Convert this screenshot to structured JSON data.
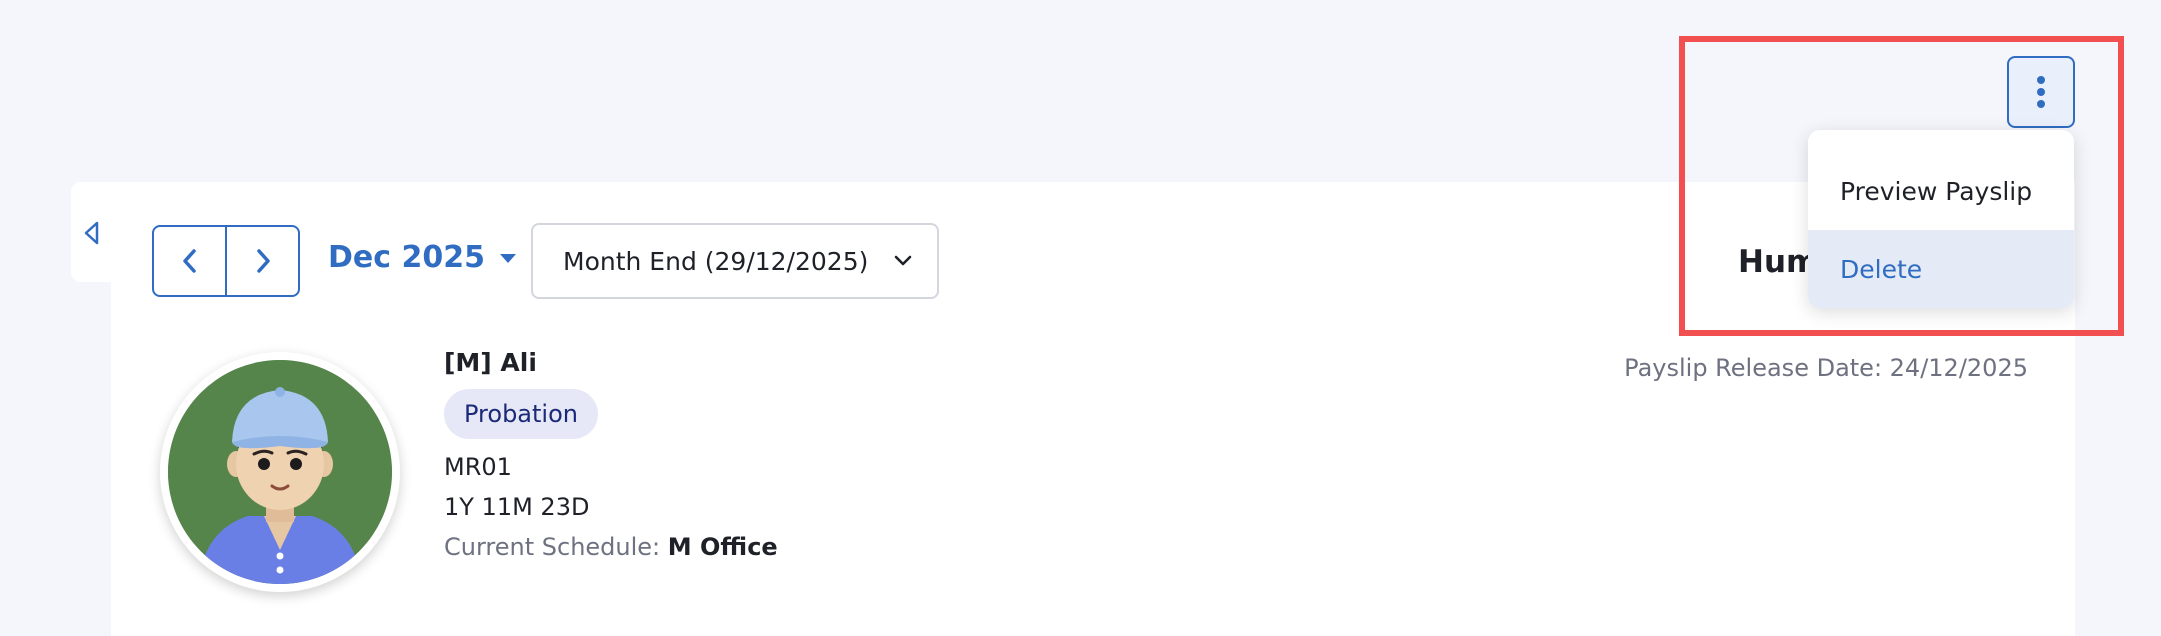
{
  "period": {
    "month_label": "Dec 2025",
    "payroll_run": "Month End (29/12/2025)"
  },
  "panel": {
    "heading_partial": "Hum"
  },
  "payslip": {
    "release_date": "Payslip Release Date: 24/12/2025"
  },
  "employee": {
    "name": "[M] Ali",
    "status_badge": "Probation",
    "employee_code": "MR01",
    "tenure": "1Y 11M 23D",
    "schedule_label": "Current Schedule:",
    "schedule_value": "M Office"
  },
  "actions_menu": {
    "items": [
      {
        "label": "Preview Payslip"
      },
      {
        "label": "Delete"
      }
    ]
  },
  "colors": {
    "accent": "#2f6cc2",
    "highlight": "#f25050",
    "badge_bg": "#e6e8f7"
  },
  "icons": {
    "collapse": "triangle-left-icon",
    "prev": "chevron-left-icon",
    "next": "chevron-right-icon",
    "month_dropdown": "caret-down-icon",
    "select_dropdown": "chevron-down-icon",
    "more": "vertical-dots-icon"
  }
}
